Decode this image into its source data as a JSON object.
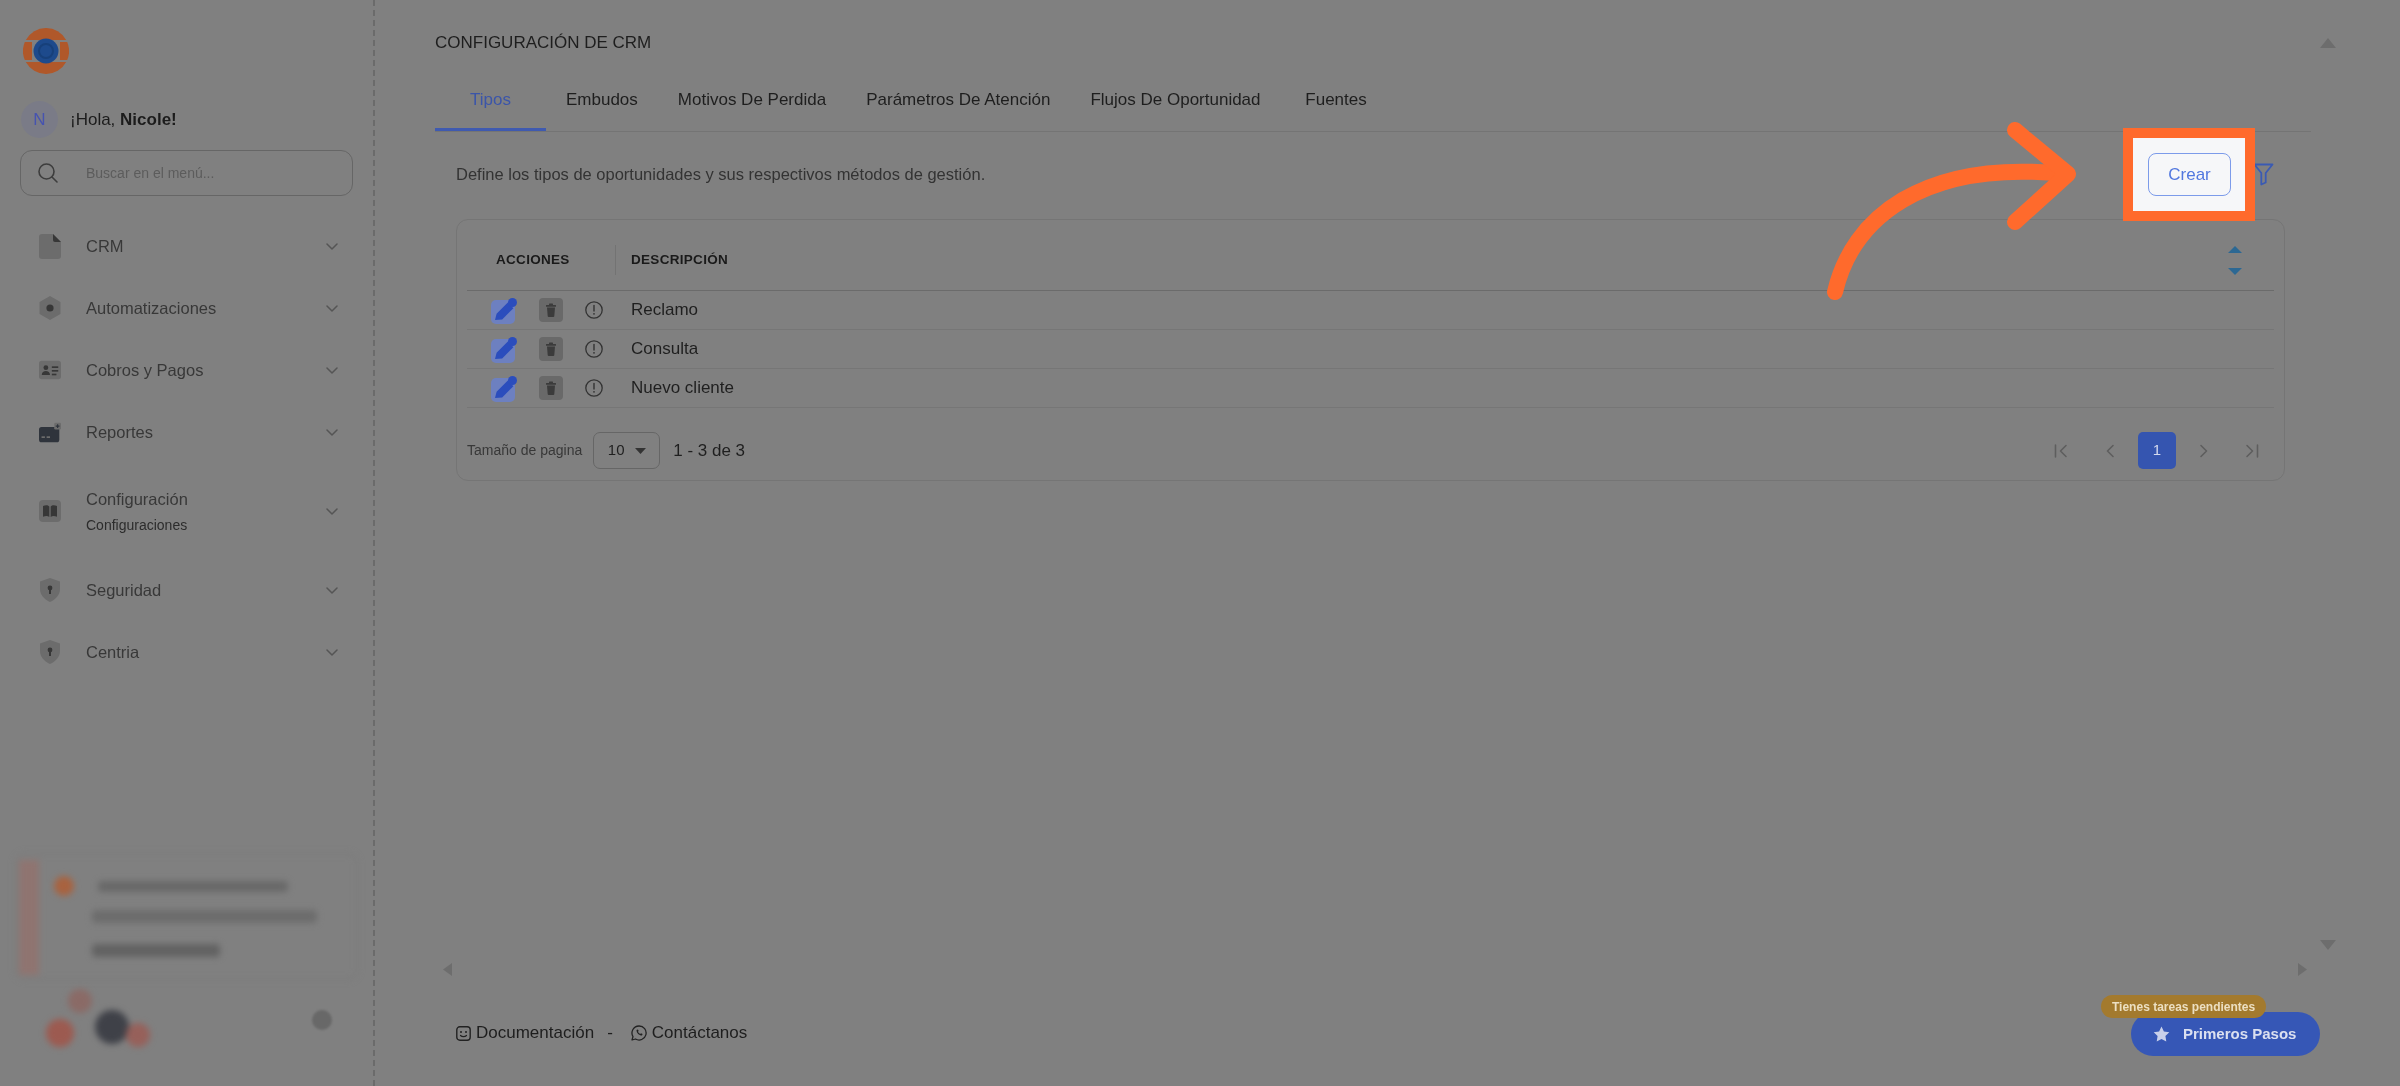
{
  "sidebar": {
    "greeting": {
      "initial": "N",
      "text": "¡Hola, **Nicole!**"
    },
    "search": {
      "placeholder": "Buscar en el menú..."
    },
    "items": [
      {
        "label": "CRM",
        "expanded": false
      },
      {
        "label": "Automatizaciones",
        "expanded": false
      },
      {
        "label": "Cobros y Pagos",
        "expanded": false
      },
      {
        "label": "Reportes",
        "expanded": false
      },
      {
        "label": "Configuración",
        "subtitle": "Configuraciones",
        "expanded": false
      },
      {
        "label": "Seguridad",
        "expanded": false
      },
      {
        "label": "Centria",
        "expanded": false
      }
    ]
  },
  "main": {
    "title": "CONFIGURACIÓN DE CRM",
    "tabs": [
      {
        "label": "Tipos",
        "selected": true
      },
      {
        "label": "Embudos",
        "selected": false
      },
      {
        "label": "Motivos De Perdida",
        "selected": false
      },
      {
        "label": "Parámetros De Atención",
        "selected": false
      },
      {
        "label": "Flujos De Oportunidad",
        "selected": false
      },
      {
        "label": "Fuentes",
        "selected": false
      }
    ],
    "description": "Define los tipos de oportunidades y sus respectivos métodos de gestión.",
    "create_button": {
      "label": "Crear",
      "highlighted": true
    },
    "table": {
      "columns": [
        "ACCIONES",
        "DESCRIPCIÓN"
      ],
      "rows": [
        {
          "description": "Reclamo"
        },
        {
          "description": "Consulta"
        },
        {
          "description": "Nuevo cliente"
        }
      ]
    },
    "pagination": {
      "page_size_label": "Tamaño de pagina",
      "page_size": "10",
      "range": "1 - 3 de 3",
      "pages": [
        {
          "label": "1",
          "selected": true
        }
      ]
    }
  },
  "footer": {
    "links": [
      "Documentación",
      "Contáctanos"
    ],
    "separator": "-"
  },
  "help": {
    "badge": "Tienes tareas pendientes",
    "button": "Primeros Pasos"
  }
}
